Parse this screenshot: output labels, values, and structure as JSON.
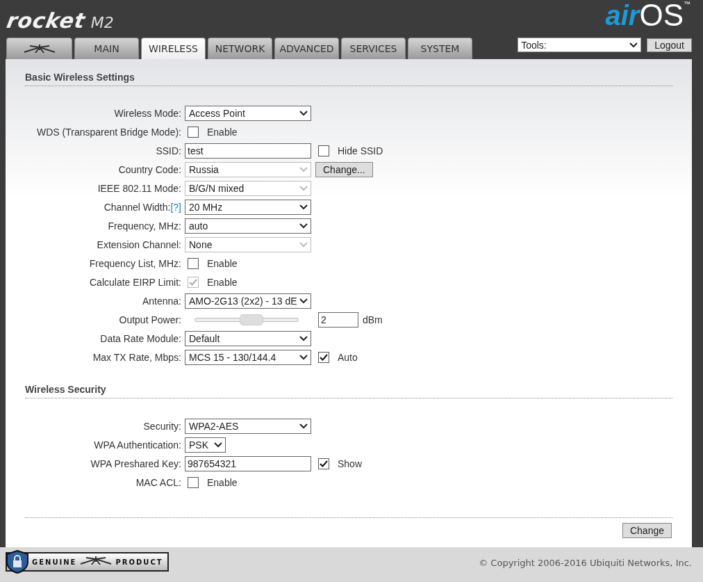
{
  "header": {
    "logo": {
      "brand": "rocket",
      "model": "M2"
    },
    "os_logo": {
      "prefix": "air",
      "name": "OS",
      "mark": "™"
    }
  },
  "tabs": [
    {
      "kind": "icon",
      "selected": false
    },
    {
      "kind": "text",
      "label": "MAIN",
      "selected": false
    },
    {
      "kind": "text",
      "label": "WIRELESS",
      "selected": true
    },
    {
      "kind": "text",
      "label": "NETWORK",
      "selected": false
    },
    {
      "kind": "text",
      "label": "ADVANCED",
      "selected": false
    },
    {
      "kind": "text",
      "label": "SERVICES",
      "selected": false
    },
    {
      "kind": "text",
      "label": "SYSTEM",
      "selected": false
    }
  ],
  "tools": {
    "value": "Tools:"
  },
  "logout": "Logout",
  "sections": [
    {
      "title": "Basic Wireless Settings",
      "rows": [
        {
          "label": "Wireless Mode:",
          "kind": "select",
          "value": "Access Point",
          "disabled": false
        },
        {
          "label": "WDS (Transparent Bridge Mode):",
          "kind": "checkbox",
          "text": "Enable",
          "checked": false,
          "disabled": false
        },
        {
          "label": "SSID:",
          "kind": "text",
          "value": "test",
          "extra": {
            "kind": "checkbox",
            "text": "Hide SSID",
            "checked": false
          }
        },
        {
          "label": "Country Code:",
          "kind": "select",
          "value": "Russia",
          "disabled": true,
          "extra": {
            "kind": "button",
            "text": "Change..."
          }
        },
        {
          "label": "IEEE 802.11 Mode:",
          "kind": "select",
          "value": "B/G/N mixed",
          "disabled": true
        },
        {
          "label": "Channel Width:",
          "help": "[?]",
          "kind": "select",
          "value": "20 MHz",
          "disabled": false
        },
        {
          "label": "Frequency, MHz:",
          "kind": "select",
          "value": "auto",
          "disabled": false
        },
        {
          "label": "Extension Channel:",
          "kind": "select",
          "value": "None",
          "disabled": true
        },
        {
          "label": "Frequency List, MHz:",
          "kind": "checkbox",
          "text": "Enable",
          "checked": false,
          "disabled": false
        },
        {
          "label": "Calculate EIRP Limit:",
          "kind": "checkbox",
          "text": "Enable",
          "checked": true,
          "disabled": true
        },
        {
          "label": "Antenna:",
          "kind": "select",
          "value": "AMO-2G13 (2x2) - 13 dE",
          "disabled": false
        },
        {
          "label": "Output Power:",
          "kind": "slider",
          "level": 0.55,
          "value": "2",
          "unit": "dBm"
        },
        {
          "label": "Data Rate Module:",
          "kind": "select",
          "value": "Default",
          "disabled": false
        },
        {
          "label": "Max TX Rate, Mbps:",
          "kind": "select",
          "value": "MCS 15 - 130/144.4",
          "disabled": false,
          "extra": {
            "kind": "checkbox",
            "text": "Auto",
            "checked": true
          }
        }
      ]
    },
    {
      "title": "Wireless Security",
      "rows": [
        {
          "label": "Security:",
          "kind": "select",
          "value": "WPA2-AES",
          "disabled": false
        },
        {
          "label": "WPA Authentication:",
          "kind": "short-select",
          "value": "PSK",
          "disabled": false
        },
        {
          "label": "WPA Preshared Key:",
          "kind": "text",
          "value": "987654321",
          "extra": {
            "kind": "checkbox",
            "text": "Show",
            "checked": true
          }
        },
        {
          "label": "MAC ACL:",
          "kind": "checkbox",
          "text": "Enable",
          "checked": false,
          "disabled": false
        }
      ]
    }
  ],
  "change_button": "Change",
  "footer": {
    "badge": {
      "left": "GENUINE",
      "right": "PRODUCT"
    },
    "copyright": "© Copyright 2006-2016 Ubiquiti Networks, Inc."
  }
}
